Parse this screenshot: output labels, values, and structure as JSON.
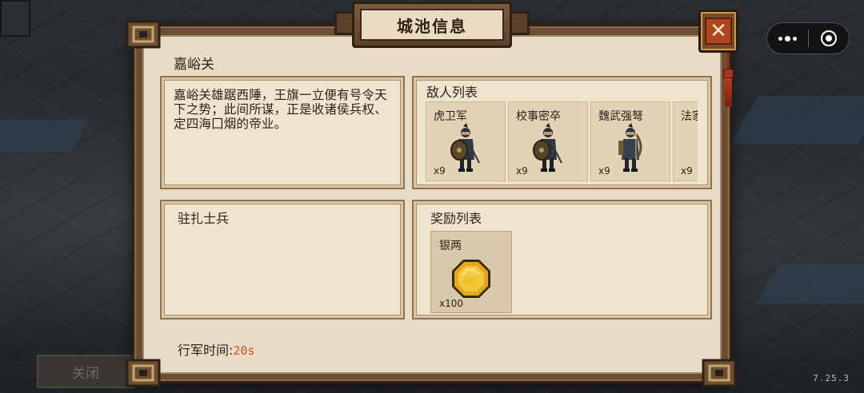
{
  "map": {
    "labels": [
      "",
      "",
      "",
      "",
      ""
    ],
    "close_button": "关闭",
    "version": "7.25.3"
  },
  "dialog": {
    "title": "城池信息",
    "close_icon": "close-x-icon",
    "city_name": "嘉峪关",
    "description": "嘉峪关雄踞西陲，王旗一立便有号令天下之势；此间所谋，正是收诸侯兵权、定四海囗烟的帝业。",
    "enemies": {
      "title": "敌人列表",
      "items": [
        {
          "name": "虎卫军",
          "count": "x9",
          "icon": "shield-soldier-icon"
        },
        {
          "name": "校事密卒",
          "count": "x9",
          "icon": "shield-soldier-icon"
        },
        {
          "name": "魏武强弩",
          "count": "x9",
          "icon": "crossbow-soldier-icon"
        },
        {
          "name": "法家",
          "count": "x9",
          "icon": "soldier-icon"
        }
      ]
    },
    "garrison": {
      "title": "驻扎士兵"
    },
    "rewards": {
      "title": "奖励列表",
      "items": [
        {
          "name": "银两",
          "count": "x100",
          "icon": "silver-coin-icon"
        }
      ]
    },
    "march": {
      "label": "行军时间:",
      "value": "20s"
    }
  },
  "colors": {
    "accent": "#d2552f",
    "panel": "#efe4cd",
    "frame": "#6b4e33",
    "close": "#b0461d"
  }
}
